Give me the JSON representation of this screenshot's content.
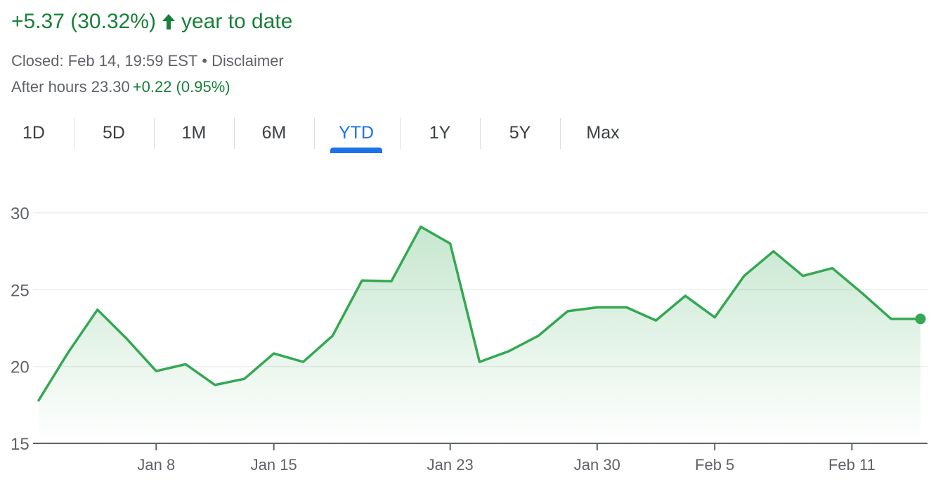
{
  "header": {
    "change_text": "+5.37 (30.32%)",
    "arrow_icon": "arrow-up-icon",
    "period_text": "year to date",
    "closed_text": "Closed: Feb 14, 19:59 EST",
    "separator": "•",
    "disclaimer_label": "Disclaimer",
    "after_hours_label": "After hours 23.30",
    "after_hours_change": "+0.22 (0.95%)"
  },
  "tabs": [
    {
      "label": "1D",
      "active": false
    },
    {
      "label": "5D",
      "active": false
    },
    {
      "label": "1M",
      "active": false
    },
    {
      "label": "6M",
      "active": false
    },
    {
      "label": "YTD",
      "active": true
    },
    {
      "label": "1Y",
      "active": false
    },
    {
      "label": "5Y",
      "active": false
    },
    {
      "label": "Max",
      "active": false
    }
  ],
  "colors": {
    "positive": "#188038",
    "line": "#34a853",
    "accent": "#1a73e8",
    "muted_text": "#5f6368",
    "grid": "#eeeeee",
    "axis": "#5f6368"
  },
  "chart_data": {
    "type": "area",
    "title": "",
    "xlabel": "",
    "ylabel": "",
    "ylim": [
      15,
      30
    ],
    "yticks": [
      30,
      25,
      20,
      15
    ],
    "grid": true,
    "x_tick_labels": [
      "Jan 8",
      "Jan 15",
      "Jan 23",
      "Jan 30",
      "Feb 5",
      "Feb 11"
    ],
    "x_tick_dates": [
      "2024-01-08",
      "2024-01-12",
      "2024-01-23",
      "2024-01-30",
      "2024-02-05",
      "2024-02-11"
    ],
    "series": [
      {
        "dates": [
          "2024-01-02",
          "2024-01-03",
          "2024-01-04",
          "2024-01-05",
          "2024-01-08",
          "2024-01-09",
          "2024-01-10",
          "2024-01-11",
          "2024-01-12",
          "2024-01-16",
          "2024-01-17",
          "2024-01-18",
          "2024-01-19",
          "2024-01-22",
          "2024-01-23",
          "2024-01-24",
          "2024-01-25",
          "2024-01-26",
          "2024-01-29",
          "2024-01-30",
          "2024-01-31",
          "2024-02-01",
          "2024-02-02",
          "2024-02-05",
          "2024-02-06",
          "2024-02-07",
          "2024-02-08",
          "2024-02-09",
          "2024-02-12",
          "2024-02-13",
          "2024-02-14"
        ],
        "values": [
          17.8,
          20.9,
          23.7,
          21.8,
          19.7,
          20.15,
          18.8,
          19.2,
          20.85,
          20.3,
          22.0,
          25.6,
          25.55,
          29.1,
          28.0,
          20.3,
          21.0,
          22.0,
          23.6,
          23.85,
          23.85,
          23.0,
          24.6,
          23.2,
          25.9,
          27.5,
          25.9,
          26.4,
          24.8,
          23.1,
          23.1
        ]
      }
    ]
  }
}
